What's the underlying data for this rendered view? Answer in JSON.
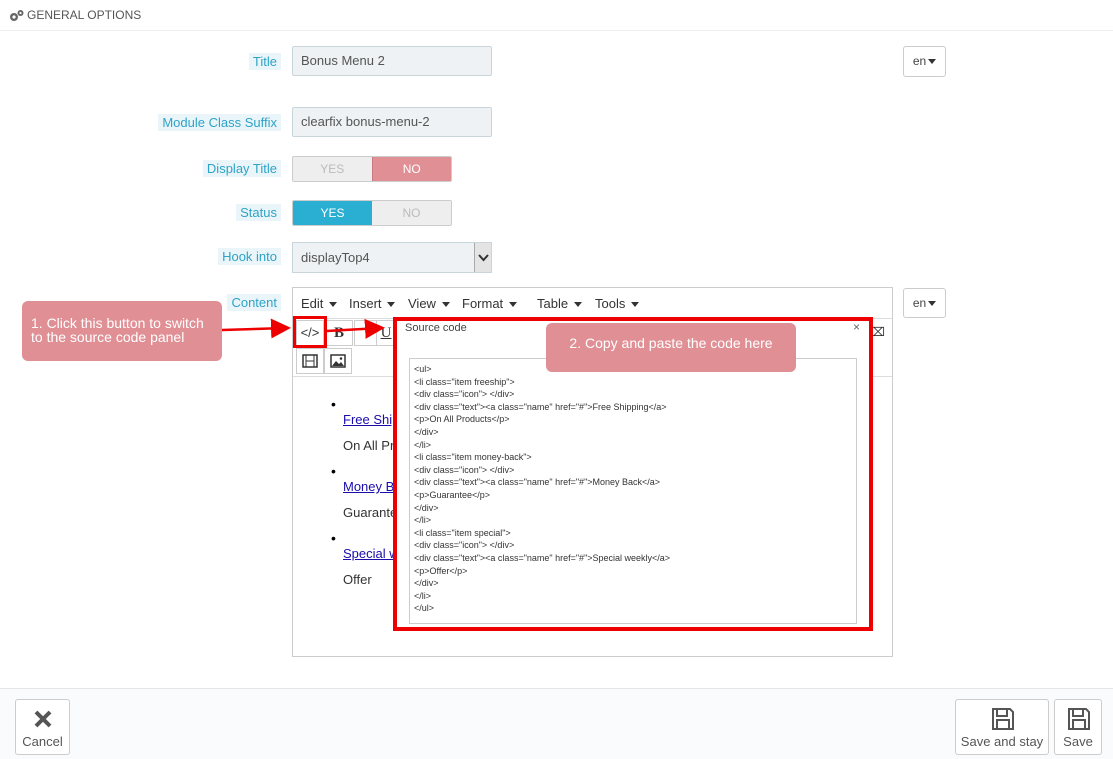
{
  "header": {
    "title": "GENERAL OPTIONS",
    "icon": "gears-icon"
  },
  "form": {
    "title": {
      "label": "Title",
      "value": "Bonus Menu 2",
      "lang": "en"
    },
    "class_suffix": {
      "label": "Module Class Suffix",
      "value": "clearfix bonus-menu-2"
    },
    "display_title": {
      "label": "Display Title",
      "yes": "YES",
      "no": "NO",
      "selected": "NO"
    },
    "status": {
      "label": "Status",
      "yes": "YES",
      "no": "NO",
      "selected": "YES"
    },
    "hook_into": {
      "label": "Hook into",
      "value": "displayTop4"
    },
    "content": {
      "label": "Content",
      "lang": "en"
    }
  },
  "editor": {
    "menu": [
      "Edit",
      "Insert",
      "View",
      "Format",
      "Table",
      "Tools"
    ],
    "toolbar": {
      "source": "</>",
      "bold": "B",
      "italic": "I",
      "underline": "U"
    },
    "preview": {
      "items": [
        {
          "link": "Free Ship",
          "text": "On All Pr"
        },
        {
          "link": "Money B",
          "text": "Guarante"
        },
        {
          "link": "Special w",
          "text": "Offer"
        }
      ]
    }
  },
  "source_dialog": {
    "title": "Source code",
    "close": "×",
    "code": [
      "<ul>",
      "<li class=\"item freeship\">",
      "<div class=\"icon\"> </div>",
      "<div class=\"text\"><a class=\"name\" href=\"#\">Free Shipping</a>",
      "<p>On All Products</p>",
      "</div>",
      "</li>",
      "<li class=\"item money-back\">",
      "<div class=\"icon\"> </div>",
      "<div class=\"text\"><a class=\"name\" href=\"#\">Money Back</a>",
      "<p>Guarantee</p>",
      "</div>",
      "</li>",
      "<li class=\"item special\">",
      "<div class=\"icon\"> </div>",
      "<div class=\"text\"><a class=\"name\" href=\"#\">Special weekly</a>",
      "<p>Offer</p>",
      "</div>",
      "</li>",
      "</ul>"
    ]
  },
  "annotations": {
    "step1": "1. Click this button to switch\nto the source code panel",
    "step2": "2. Copy and paste the code here"
  },
  "footer": {
    "cancel": "Cancel",
    "save_and_stay": "Save and stay",
    "save": "Save"
  },
  "colors": {
    "label_blue": "#2ea3c6",
    "switch_yes": "#2aafd2",
    "switch_no": "#e08f95",
    "annotation_red": "#ee0000"
  }
}
